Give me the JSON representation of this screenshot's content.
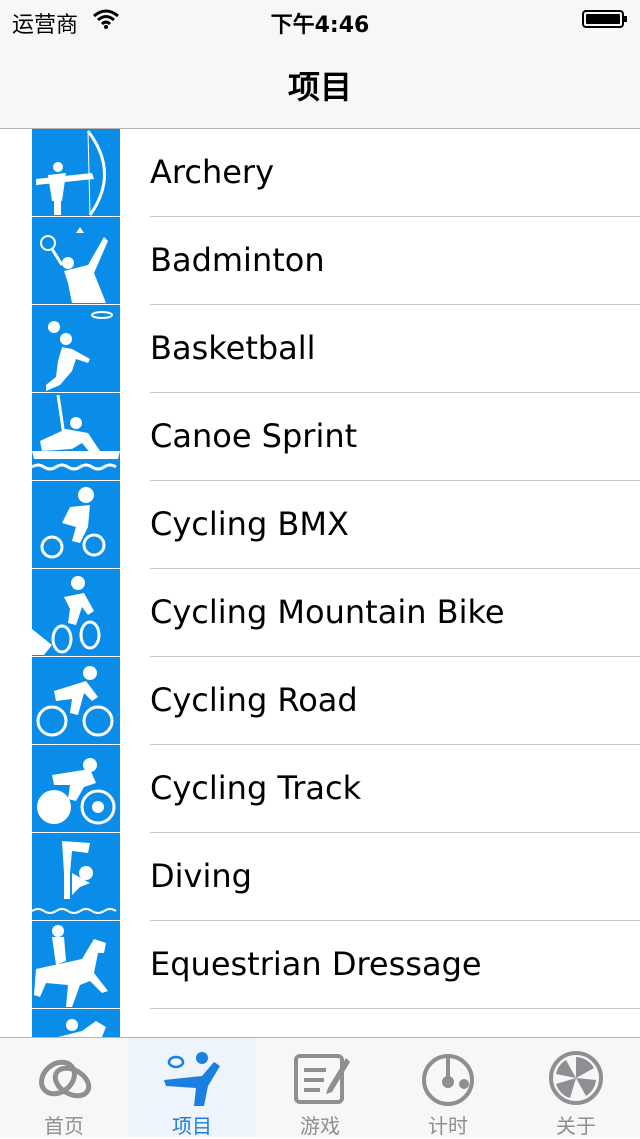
{
  "status_bar": {
    "carrier": "运营商",
    "time": "下午4:46"
  },
  "nav": {
    "title": "项目"
  },
  "sports": [
    {
      "label": "Archery",
      "icon": "archery-icon"
    },
    {
      "label": "Badminton",
      "icon": "badminton-icon"
    },
    {
      "label": "Basketball",
      "icon": "basketball-icon"
    },
    {
      "label": "Canoe Sprint",
      "icon": "canoe-sprint-icon"
    },
    {
      "label": "Cycling BMX",
      "icon": "cycling-bmx-icon"
    },
    {
      "label": "Cycling Mountain Bike",
      "icon": "cycling-mountain-bike-icon"
    },
    {
      "label": "Cycling Road",
      "icon": "cycling-road-icon"
    },
    {
      "label": "Cycling Track",
      "icon": "cycling-track-icon"
    },
    {
      "label": "Diving",
      "icon": "diving-icon"
    },
    {
      "label": "Equestrian Dressage",
      "icon": "equestrian-dressage-icon"
    },
    {
      "label": "",
      "icon": "equestrian-icon"
    }
  ],
  "tabs": [
    {
      "label": "首页",
      "icon": "home-rings-icon"
    },
    {
      "label": "项目",
      "icon": "sports-icon"
    },
    {
      "label": "游戏",
      "icon": "game-notepad-icon"
    },
    {
      "label": "计时",
      "icon": "timer-icon"
    },
    {
      "label": "关于",
      "icon": "about-icon"
    }
  ],
  "colors": {
    "icon_blue": "#0a8de9",
    "tab_active": "#1a7fe0",
    "tab_inactive": "#8e8e93"
  }
}
